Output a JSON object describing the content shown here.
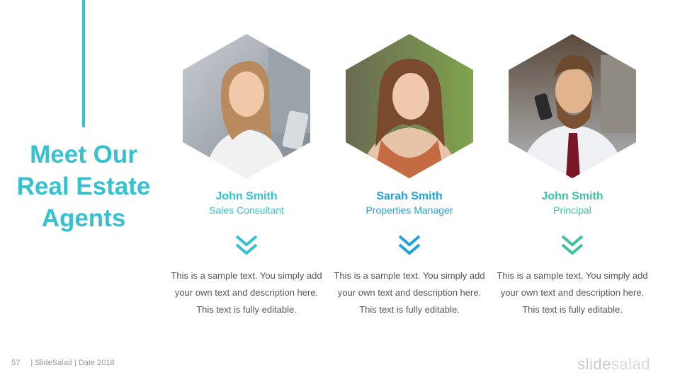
{
  "slide": {
    "title": "Meet Our Real Estate Agents",
    "accent_color": "#35c1cf"
  },
  "agents": [
    {
      "name": "John Smith",
      "role": "Sales Consultant",
      "color": "#35c1cf",
      "description": "This is a sample text. You simply add your own text and description here. This text is fully editable.",
      "photo": "woman-on-phone-photo"
    },
    {
      "name": "Sarah Smith",
      "role": "Properties Manager",
      "color": "#1fa3d8",
      "description": "This is a sample text. You simply add your own text and description here. This text is fully editable.",
      "photo": "woman-in-scarf-photo"
    },
    {
      "name": "John Smith",
      "role": "Principal",
      "color": "#3fc1a2",
      "description": "This is a sample text. You simply add your own text and description here. This text is fully editable.",
      "photo": "bearded-man-on-phone-photo"
    }
  ],
  "footer": {
    "page_number": "57",
    "info": "| SlideSalad | Date 2018",
    "brand_part1": "slide",
    "brand_part2": "salad"
  },
  "icons": [
    "chevron-double-down-icon"
  ]
}
